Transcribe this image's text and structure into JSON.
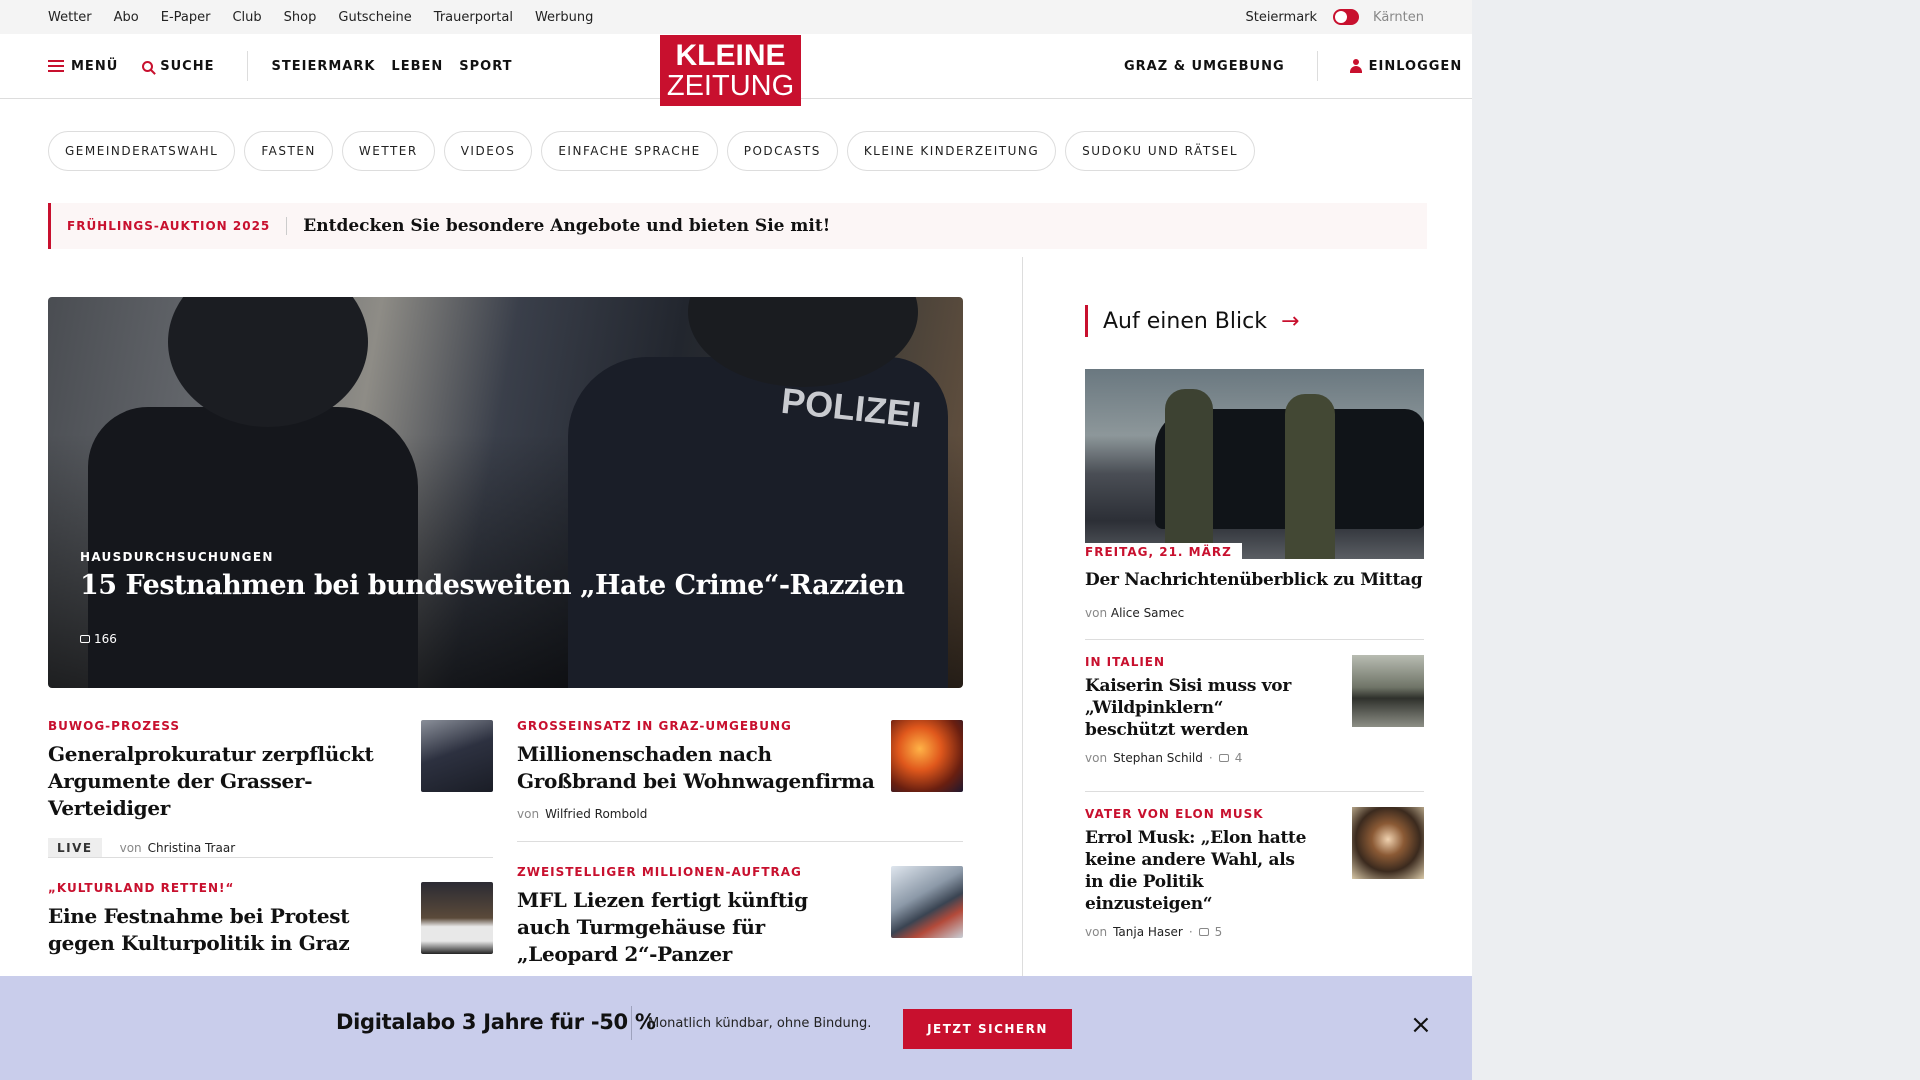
{
  "utility_bar": {
    "links": [
      "Wetter",
      "Abo",
      "E-Paper",
      "Club",
      "Shop",
      "Gutscheine",
      "Trauerportal",
      "Werbung"
    ],
    "region_left": "Steiermark",
    "region_right": "Kärnten"
  },
  "header": {
    "menu_label": "MENÜ",
    "search_label": "SUCHE",
    "nav": [
      "STEIERMARK",
      "LEBEN",
      "SPORT"
    ],
    "logo_line1": "KLEINE",
    "logo_line2": "ZEITUNG",
    "region_link": "GRAZ & UMGEBUNG",
    "login_label": "EINLOGGEN"
  },
  "chips": [
    "GEMEINDERATSWAHL",
    "FASTEN",
    "WETTER",
    "VIDEOS",
    "EINFACHE SPRACHE",
    "PODCASTS",
    "KLEINE KINDERZEITUNG",
    "SUDOKU UND RÄTSEL"
  ],
  "promo": {
    "tag": "FRÜHLINGS-AUKTION 2025",
    "text": "Entdecken Sie besondere Angebote und bieten Sie mit!"
  },
  "hero": {
    "badge_text": "POLIZEI",
    "kicker": "HAUSDURCHSUCHUNGEN",
    "title": "15 Festnahmen bei bundesweiten „Hate Crime“-Razzien",
    "comments": "166"
  },
  "articles": [
    {
      "kicker": "BUWOG-PROZESS",
      "title_l1": "Generalprokuratur zerpflückt",
      "title_l2": "Argumente der Grasser-Verteidiger",
      "live": "LIVE",
      "by": "von",
      "author": "Christina Traar"
    },
    {
      "kicker": "GROSSEINSATZ IN GRAZ-UMGEBUNG",
      "title_l1": "Millionenschaden nach",
      "title_l2": "Großbrand bei Wohnwagenfirma",
      "by": "von",
      "author": "Wilfried Rombold"
    },
    {
      "kicker": "„KULTURLAND RETTEN!“",
      "title_l1": "Eine Festnahme bei Protest",
      "title_l2": "gegen Kulturpolitik in Graz"
    },
    {
      "kicker": "ZWEISTELLIGER MILLIONEN-AUFTRAG",
      "title_l1": "MFL Liezen fertigt künftig",
      "title_l2": "auch Turmgehäuse für",
      "title_l3": "„Leopard 2“-Panzer"
    }
  ],
  "sidebar": {
    "heading": "Auf einen Blick",
    "lead": {
      "date": "FREITAG, 21. MÄRZ",
      "title": "Der Nachrichtenüberblick zu Mittag",
      "by": "von",
      "author": "Alice Samec"
    },
    "items": [
      {
        "kicker": "IN ITALIEN",
        "title": "Kaiserin Sisi muss vor „Wildpinklern“ beschützt werden",
        "by": "von",
        "author": "Stephan Schild",
        "comments": "4"
      },
      {
        "kicker": "VATER VON ELON MUSK",
        "title": "Errol Musk: „Elon hatte keine andere Wahl, als in die Politik einzusteigen“",
        "by": "von",
        "author": "Tanja Haser",
        "comments": "5"
      }
    ]
  },
  "banner": {
    "title": "Digitalabo 3 Jahre für -50 %",
    "subtitle": "Monatlich kündbar, ohne Bindung.",
    "button": "JETZT SICHERN",
    "close": "×"
  },
  "colors": {
    "brand_red": "#c8102e",
    "banner_bg": "#c9cdeb"
  }
}
